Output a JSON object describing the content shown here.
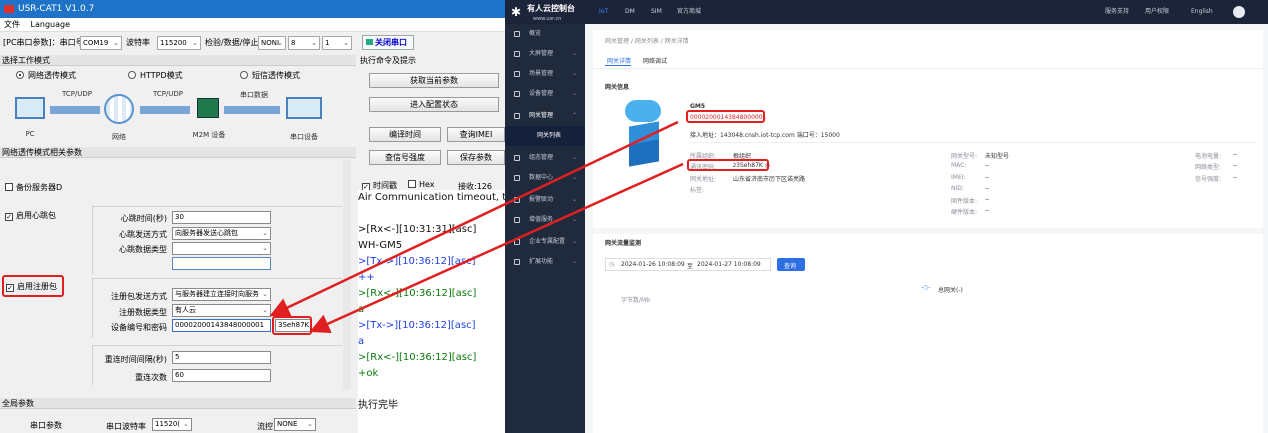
{
  "left_app": {
    "title": "USR-CAT1 V1.0.7",
    "menu": [
      "文件",
      "Language"
    ],
    "pc_params": {
      "prefix": "[PC串口参数]：串口号",
      "port": "COM19",
      "baud_label": "波特率",
      "baud": "115200",
      "check_label": "检验/数据/停止",
      "parity": "NONI",
      "data_bits": "8",
      "stop_bits": "1",
      "close_port_label": "关闭串口"
    },
    "work_mode": {
      "header": "选择工作模式",
      "modes": [
        "网络透传模式",
        "HTTPD模式",
        "短信透传模式"
      ],
      "diagram": {
        "link1": "TCP/UDP",
        "link2": "TCP/UDP",
        "link3": "串口数据",
        "pc": "PC",
        "net": "网络",
        "m2m": "M2M 设备",
        "serial": "串口设备"
      }
    },
    "net_params": {
      "header": "网络透传模式相关参数",
      "backup_server": "备份服务器D",
      "heartbeat": {
        "enable": "启用心跳包",
        "time_label": "心跳时间(秒)",
        "time": "30",
        "send_mode_label": "心跳发送方式",
        "send_mode": "向服务器发送心跳包",
        "data_type_label": "心跳数据类型",
        "data_type": "",
        "data": ""
      },
      "register": {
        "enable": "启用注册包",
        "send_mode_label": "注册包发送方式",
        "send_mode": "与服务器建立连接时向服务",
        "data_type_label": "注册数据类型",
        "data_type": "有人云",
        "id_pwd_label": "设备编号和密码",
        "device_id": "00002000143848000001",
        "password": "3Seh87K"
      },
      "reconnect_interval_label": "重连时间间隔(秒)",
      "reconnect_interval": "5",
      "reconnect_count_label": "重连次数",
      "reconnect_count": "60"
    },
    "global": {
      "header": "全局参数",
      "serial_label": "串口参数",
      "baud_label": "串口波特率",
      "baud": "11520(",
      "flow_label": "流控",
      "flow": "NONE"
    },
    "commands": {
      "header": "执行命令及提示",
      "get_params": "获取当前参数",
      "enter_config": "进入配置状态",
      "edit_time": "编译时间",
      "query_imei": "查询IMEI",
      "query_signal": "查信号强度",
      "save_params": "保存参数"
    },
    "log_options": {
      "time_label": "时间戳",
      "hex_label": "Hex",
      "recv_label": "接收:126"
    },
    "log": [
      {
        "t": "bk",
        "s": "Air Communication timeout, the mod"
      },
      {
        "t": "bk",
        "s": ""
      },
      {
        "t": "bk",
        "s": ">[Rx<-][10:31:31][asc]"
      },
      {
        "t": "bk",
        "s": "WH-GM5"
      },
      {
        "t": "tx",
        "s": ">[Tx->][10:36:12][asc]"
      },
      {
        "t": "tx",
        "s": "++"
      },
      {
        "t": "rx",
        "s": ">[Rx<-][10:36:12][asc]"
      },
      {
        "t": "rx",
        "s": "a"
      },
      {
        "t": "tx",
        "s": ">[Tx->][10:36:12][asc]"
      },
      {
        "t": "tx",
        "s": "a"
      },
      {
        "t": "rx",
        "s": ">[Rx<-][10:36:12][asc]"
      },
      {
        "t": "rx",
        "s": "+ok"
      },
      {
        "t": "bk",
        "s": ""
      },
      {
        "t": "bk",
        "s": "执行完毕"
      }
    ]
  },
  "web": {
    "brand": "有人云控制台",
    "brand_sub": "www.usr.cn",
    "top_tabs": [
      "IoT",
      "DM",
      "SIM",
      "官方商城"
    ],
    "top_right": [
      "服务支持",
      "用户权限",
      "English"
    ],
    "sidebar": [
      {
        "label": "概览"
      },
      {
        "label": "大屏管理"
      },
      {
        "label": "场景管理"
      },
      {
        "label": "设备管理"
      },
      {
        "label": "网关管理"
      },
      {
        "label": "网关列表"
      },
      {
        "label": "组态管理"
      },
      {
        "label": "数据中心"
      },
      {
        "label": "报警联动"
      },
      {
        "label": "增值服务"
      },
      {
        "label": "企业专属配置"
      },
      {
        "label": "扩展功能"
      }
    ],
    "breadcrumb": "网关管理 / 网关列表 / 网关详情",
    "tabs": [
      "网关详情",
      "网络调试"
    ],
    "section_info": "网关信息",
    "gateway": {
      "name": "GM5",
      "sn": "00002000143848000001",
      "access": "接入地址：143048.cnsh.iot-tcp.com  端口号：15000",
      "fields_left": [
        [
          "所属组织:",
          "根组织"
        ],
        [
          "通讯密码:",
          "z3Seh87K ◎"
        ],
        [
          "网关地址:",
          "山东省济南市历下区诺亮路"
        ],
        [
          "标签:",
          ""
        ]
      ],
      "fields_mid": [
        [
          "网关型号:",
          "未知型号"
        ],
        [
          "MAC:",
          "--"
        ],
        [
          "IMEI:",
          "--"
        ],
        [
          "NID:",
          "--"
        ],
        [
          "固件版本:",
          "--"
        ],
        [
          "硬件版本:",
          "--"
        ]
      ],
      "fields_right": [
        [
          "电池电量:",
          "--"
        ],
        [
          "网络类型:",
          "--"
        ],
        [
          "信号强度:",
          "--"
        ]
      ]
    },
    "traffic": {
      "title": "网关流量监测",
      "start": "2024-01-26 10:08:09",
      "to": "至",
      "end": "2024-01-27 10:08:09",
      "query": "查询",
      "legend": "总网关(-)",
      "yunit": "字节数/Mb"
    }
  }
}
